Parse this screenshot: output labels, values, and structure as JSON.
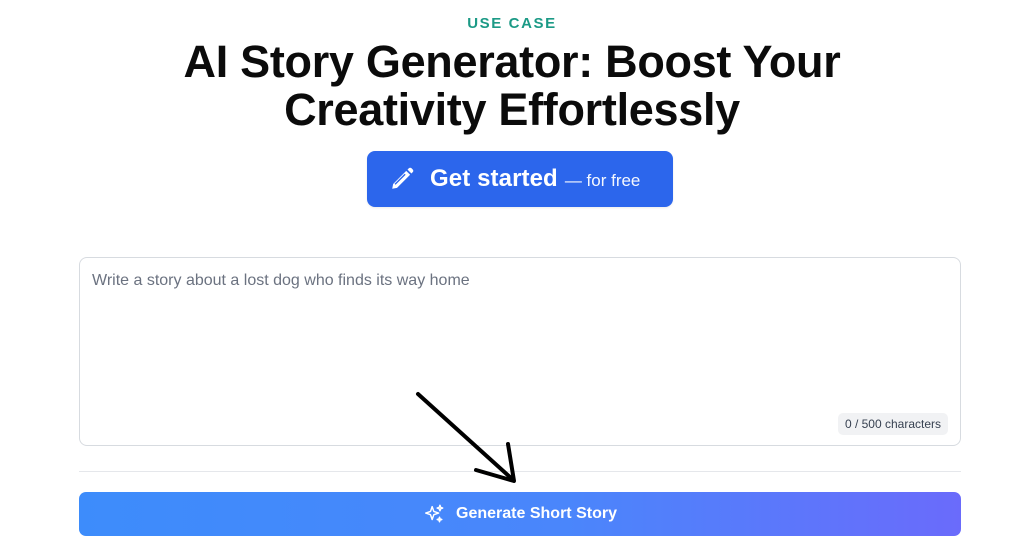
{
  "eyebrow": "USE CASE",
  "title": "AI Story Generator: Boost Your Creativity Effortlessly",
  "cta": {
    "label": "Get started",
    "sublabel": "— for free",
    "icon": "pencil-icon",
    "color": "#2c66ec"
  },
  "editor": {
    "placeholder": "Write a story about a lost dog who finds its way home",
    "value": "",
    "counter": "0 / 500 characters"
  },
  "generate_button": {
    "label": "Generate Short Story",
    "icon": "sparkle-icon",
    "gradient": [
      "#3d8cfb",
      "#6a6bfb"
    ]
  },
  "annotation": {
    "icon": "arrow-pointer-icon"
  },
  "colors": {
    "accent_teal": "#1c9a86",
    "primary_blue": "#2c66ec"
  }
}
